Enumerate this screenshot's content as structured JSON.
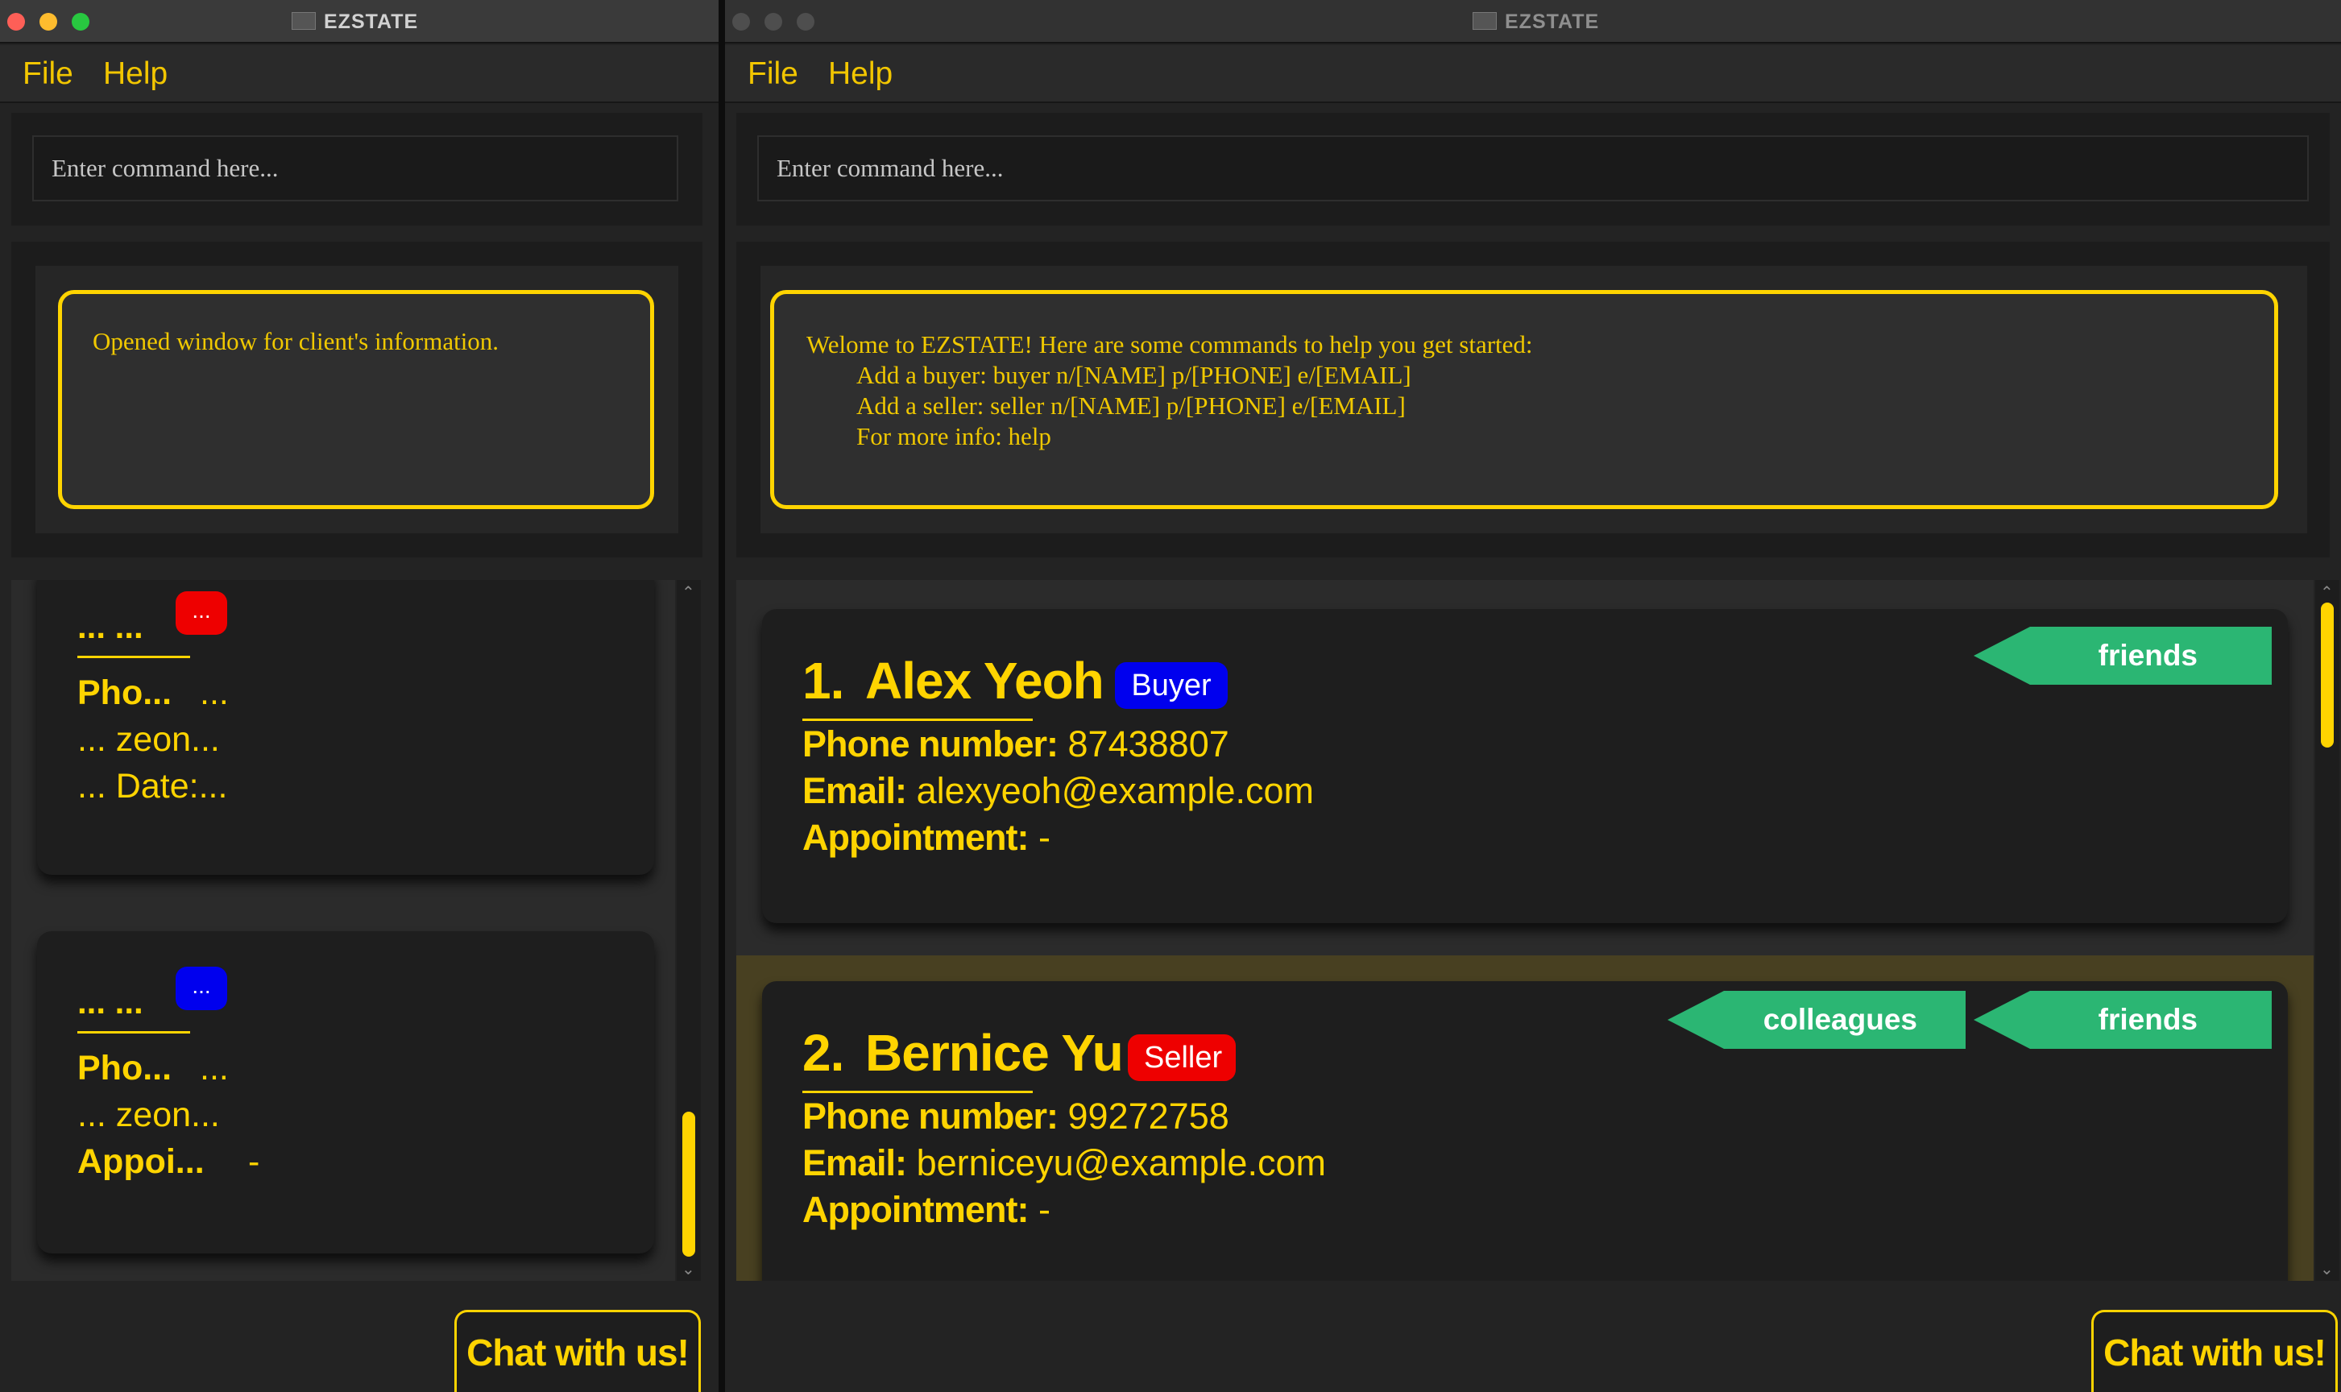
{
  "left_window": {
    "title": "EZSTATE",
    "menu": [
      "File",
      "Help"
    ],
    "command_placeholder": "Enter command here...",
    "result_text": "Opened window for client's information.",
    "cards": [
      {
        "name": "... ...",
        "badge": "...",
        "badge_color": "#ee0000",
        "line1_label": "Pho...",
        "line1_value": "...",
        "line2": "... zeon...",
        "line3": "... Date:..."
      },
      {
        "name": "... ...",
        "badge": "...",
        "badge_color": "#0000ee",
        "line1_label": "Pho...",
        "line1_value": "...",
        "line2": "... zeon...",
        "line3_label": "Appoi...",
        "line3_value": "-"
      }
    ],
    "chat_button": "Chat with us!"
  },
  "right_window": {
    "title": "EZSTATE",
    "menu": [
      "File",
      "Help"
    ],
    "command_placeholder": "Enter command here...",
    "result_text": "Welome to EZSTATE! Here are some commands to help you get started:\n        Add a buyer: buyer n/[NAME] p/[PHONE] e/[EMAIL]\n        Add a seller: seller n/[NAME] p/[PHONE] e/[EMAIL]\n        For more info: help",
    "clients": [
      {
        "index": "1.",
        "name": "Alex Yeoh",
        "role": "Buyer",
        "phone_label": "Phone number:",
        "phone": "87438807",
        "email_label": "Email:",
        "email": "alexyeoh@example.com",
        "appointment_label": "Appointment:",
        "appointment": "-",
        "tags": [
          "friends"
        ]
      },
      {
        "index": "2.",
        "name": "Bernice Yu",
        "role": "Seller",
        "phone_label": "Phone number:",
        "phone": "99272758",
        "email_label": "Email:",
        "email": "berniceyu@example.com",
        "appointment_label": "Appointment:",
        "appointment": "-",
        "tags": [
          "colleagues",
          "friends"
        ]
      }
    ],
    "chat_button": "Chat with us!"
  },
  "colors": {
    "accent": "#ffd400",
    "buyer": "#0000ee",
    "seller": "#ee0000",
    "tag": "#2bb673",
    "background": "#232323"
  }
}
